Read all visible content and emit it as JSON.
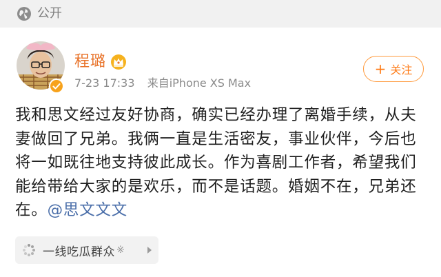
{
  "header": {
    "visibility_label": "公开",
    "visibility_icon": "globe-icon"
  },
  "post": {
    "author": {
      "name": "程璐",
      "badge_icon": "vip-crown-icon",
      "verified_icon": "verified-badge",
      "name_color": "#e8732a"
    },
    "date": "7-23 17:33",
    "source": "来自iPhone XS Max",
    "follow_label": "关注",
    "text": "我和思文经过友好协商，确实已经办理了离婚手续，从夫妻做回了兄弟。我俩一直是生活密友，事业伙伴，今后也将一如既往地支持彼此成长。作为喜剧工作者，希望我们能给带给大家的是欢乐，而不是话题。婚姻不在，兄弟还在。",
    "mention": "@思文文文",
    "mention_color": "#4a6ea9"
  },
  "topic": {
    "label": "一线吃瓜群众",
    "sparkle": "※",
    "icon": "spinner-icon"
  },
  "colors": {
    "accent": "#ff7a14",
    "topbar_bg": "#f1f1f1"
  }
}
